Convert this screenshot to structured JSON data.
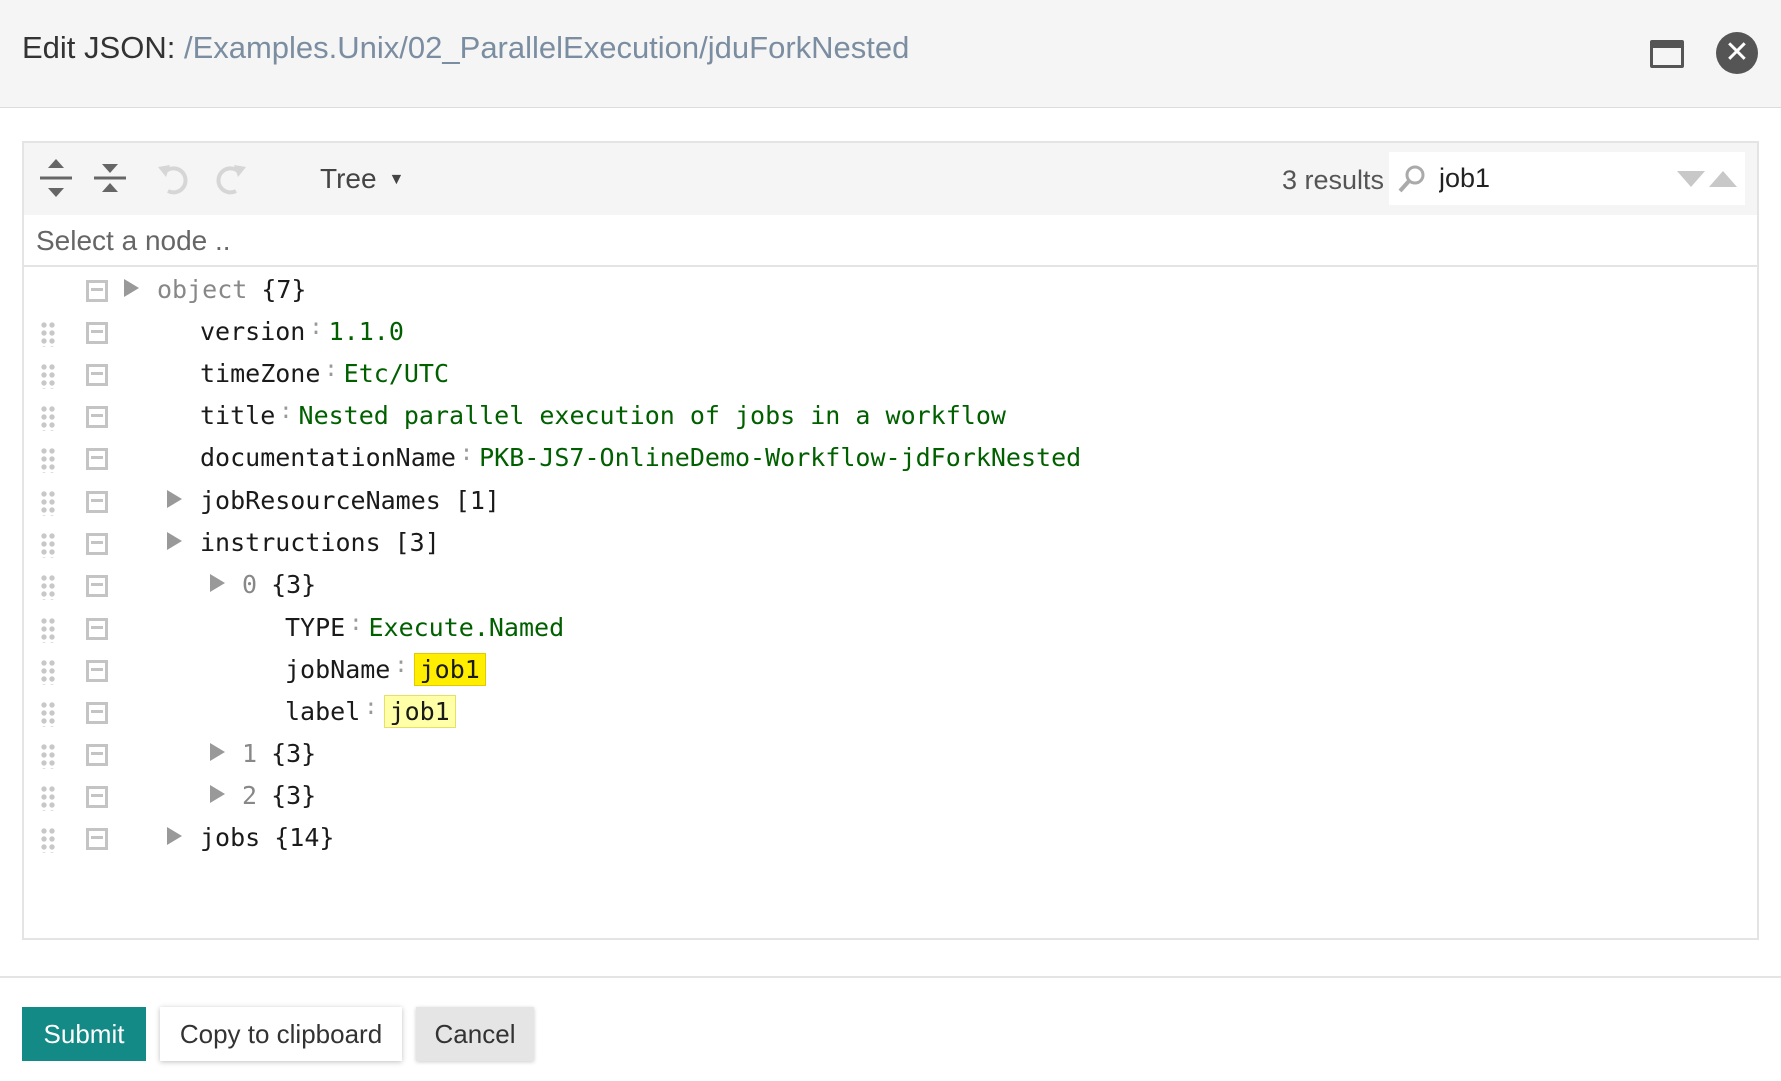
{
  "dialog": {
    "title_label": "Edit JSON:",
    "title_path": "/Examples.Unix/02_ParallelExecution/jduForkNested"
  },
  "toolbar": {
    "mode": "Tree",
    "results": "3 results",
    "search_value": "job1"
  },
  "nodebar": {
    "placeholder": "Select a node .."
  },
  "tree": {
    "root_label": "object",
    "root_count": "{7}",
    "version_key": "version",
    "version_value": "1.1.0",
    "timezone_key": "timeZone",
    "timezone_value": "Etc/UTC",
    "title_key": "title",
    "title_value": "Nested parallel execution of jobs in a workflow",
    "docname_key": "documentationName",
    "docname_value": "PKB-JS7-OnlineDemo-Workflow-jdForkNested",
    "jobres_key": "jobResourceNames",
    "jobres_count": "[1]",
    "instructions_key": "instructions",
    "instructions_count": "[3]",
    "item0_index": "0",
    "item0_count": "{3}",
    "type_key": "TYPE",
    "type_value": "Execute.Named",
    "jobname_key": "jobName",
    "jobname_value": "job1",
    "label_key": "label",
    "label_value": "job1",
    "item1_index": "1",
    "item1_count": "{3}",
    "item2_index": "2",
    "item2_count": "{3}",
    "jobs_key": "jobs",
    "jobs_count": "{14}"
  },
  "footer": {
    "submit": "Submit",
    "copy": "Copy to clipboard",
    "cancel": "Cancel"
  },
  "colors": {
    "accent": "#148a86",
    "value_green": "#006000",
    "highlight_active": "#ffee00",
    "highlight": "#ffffa8"
  }
}
